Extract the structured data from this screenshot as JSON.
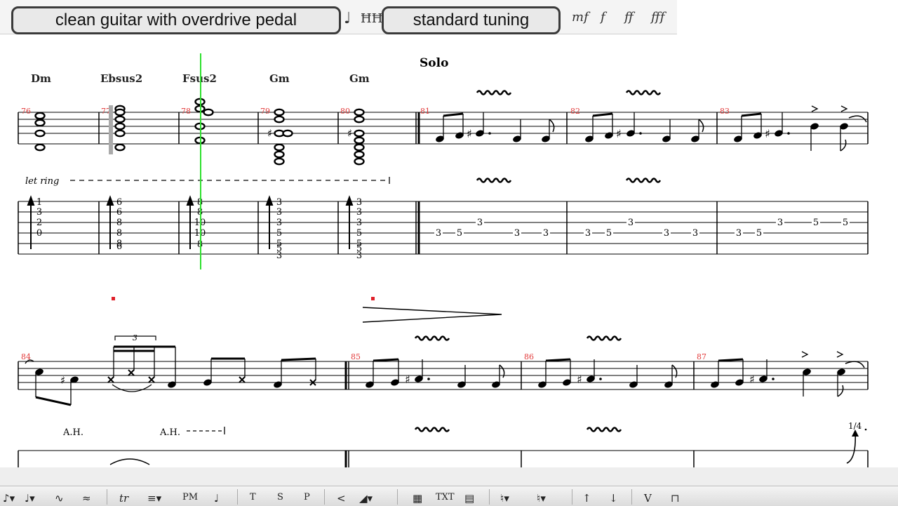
{
  "top_toolbar": {
    "sound_label": "clean guitar with overdrive pedal",
    "tuning_label": "standard tuning"
  },
  "section_marker": "Solo",
  "chords": [
    "Dm",
    "Ebsus2",
    "Fsus2",
    "Gm",
    "Gm"
  ],
  "measure_numbers": [
    "76",
    "77",
    "78",
    "79",
    "80",
    "81",
    "82",
    "83",
    "84",
    "85",
    "86",
    "87"
  ],
  "let_ring": "let ring",
  "artificial_harmonics": [
    "A.H.",
    "A.H."
  ],
  "bend_amount": "1/4",
  "tuplet": "3",
  "tab_columns": {
    "m76": [
      "1",
      "3",
      "2",
      "0"
    ],
    "m77": [
      "6",
      "6",
      "8",
      "8",
      "8",
      "6"
    ],
    "m78": [
      "8",
      "8",
      "10",
      "10",
      "8"
    ],
    "m79": [
      "3",
      "3",
      "3",
      "5",
      "5",
      "5",
      "3"
    ],
    "m80": [
      "3",
      "3",
      "3",
      "5",
      "5",
      "5",
      "3"
    ]
  },
  "solo_tab": {
    "m81": [
      "3",
      "5",
      "3",
      "3",
      "3"
    ],
    "m82": [
      "3",
      "5",
      "3",
      "3",
      "3"
    ],
    "m83": [
      "3",
      "5",
      "3",
      "5",
      "5"
    ]
  },
  "bottom_toolbar": {
    "items": [
      "tr",
      "PM",
      "T",
      "S",
      "P",
      "TXT"
    ]
  },
  "colors": {
    "measure_number": "#e23a3a",
    "playback_cursor": "#2ee02e",
    "staff": "#000000",
    "toolbar": "#f4f4f4"
  }
}
